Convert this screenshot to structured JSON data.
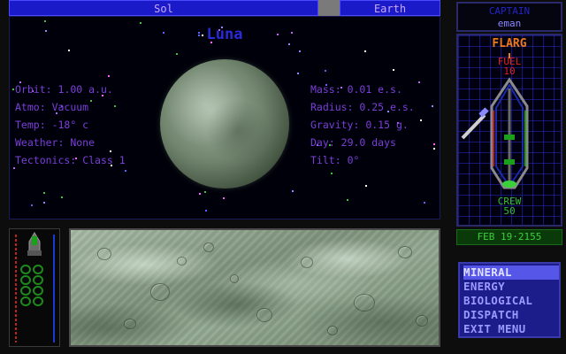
{
  "header": {
    "system_name": "Sol",
    "planet_tab": "Earth"
  },
  "planet": {
    "name": "Luna",
    "stats_left": [
      {
        "label": "Orbit:",
        "value": "1.00 a.u."
      },
      {
        "label": "Atmo:",
        "value": "Vacuum"
      },
      {
        "label": "Temp:",
        "value": "-18° c"
      },
      {
        "label": "Weather:",
        "value": "None"
      },
      {
        "label": "Tectonics:",
        "value": "Class 1"
      }
    ],
    "stats_right": [
      {
        "label": "Mass:",
        "value": "0.01 e.s."
      },
      {
        "label": "Radius:",
        "value": "0.25 e.s."
      },
      {
        "label": "Gravity:",
        "value": "0.15 g."
      },
      {
        "label": "Day:",
        "value": "29.0 days"
      },
      {
        "label": "Tilt:",
        "value": "0°"
      }
    ],
    "colors": {
      "sphere": "#72866f",
      "name": "#2a2ad8",
      "stats": "#7a3fd8"
    }
  },
  "captain": {
    "label": "CAPTAIN",
    "name": "eman"
  },
  "ship": {
    "name": "FLARG",
    "fuel_label": "FUEL",
    "fuel_value": "10",
    "crew_label": "CREW",
    "crew_value": "50"
  },
  "date": "FEB 19·2155",
  "menu": {
    "items": [
      {
        "label": "MINERAL",
        "active": true
      },
      {
        "label": "ENERGY",
        "active": false
      },
      {
        "label": "BIOLOGICAL",
        "active": false
      },
      {
        "label": "DISPATCH",
        "active": false
      },
      {
        "label": "EXIT MENU",
        "active": false
      }
    ]
  },
  "icons": {
    "lander": "lander-icon",
    "ship": "ship-icon",
    "planet_surface": "terrain-map"
  }
}
